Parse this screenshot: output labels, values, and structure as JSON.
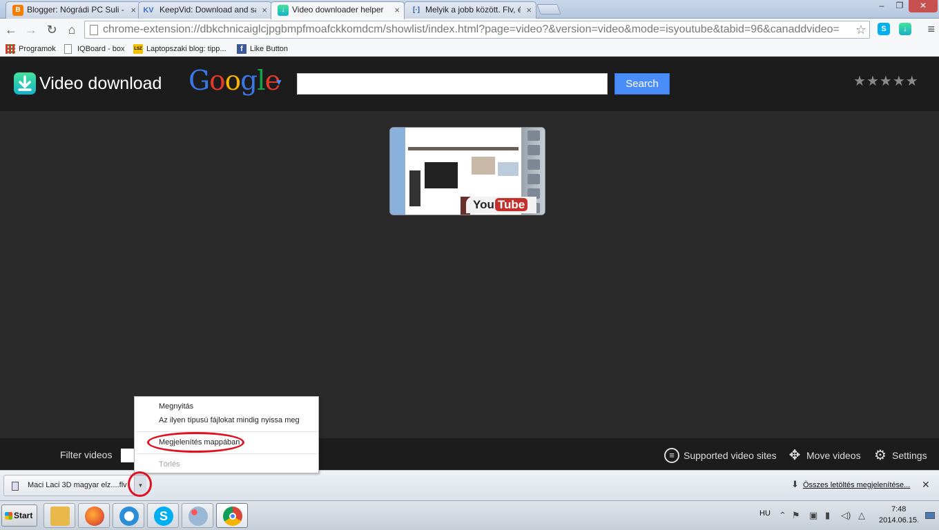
{
  "tabs": [
    {
      "label": "Blogger: Nógrádi PC Suli - Be",
      "icon": "blogger-icon",
      "color": "#f57d00"
    },
    {
      "label": "KeepVid: Download and save",
      "icon": "keepvid-icon",
      "badge": "KV"
    },
    {
      "label": "Video downloader helper",
      "icon": "video-download-icon",
      "color": "#2fc5a6"
    },
    {
      "label": "Melyik a jobb között. Flv, és",
      "icon": "page-icon",
      "badge": "[·]"
    }
  ],
  "window": {
    "minimize": "–",
    "maximize": "❐",
    "close": "✕"
  },
  "toolbar": {
    "url": "chrome-extension://dbkchnicaiglcjpgbmpfmoafckkomdcm/showlist/index.html?page=video?&version=video&mode=isyoutube&tabid=96&canaddvideo="
  },
  "bookmarks": [
    {
      "label": "Programok",
      "icon": "apps-grid-icon"
    },
    {
      "label": "IQBoard - box",
      "icon": "page-icon"
    },
    {
      "label": "Laptopszaki blog: tipp...",
      "icon": "laptopszaki-icon",
      "badge": "LSZ"
    },
    {
      "label": "Like Button",
      "icon": "facebook-icon",
      "badge": "f"
    }
  ],
  "app": {
    "title": "Video download",
    "google": "Google",
    "search_label": "Search",
    "rating_stars": 5
  },
  "thumbnail": {
    "yt_you": "You",
    "yt_tube": "Tube"
  },
  "footer": {
    "filter_label": "Filter videos",
    "supported_sites": "Supported video sites",
    "move_videos": "Move videos",
    "settings": "Settings"
  },
  "context_menu": {
    "open": "Megnyitás",
    "always_open": "Az ilyen típusú fájlokat mindig nyissa meg",
    "show_in_folder": "Megjelenítés mappában",
    "delete": "Törlés"
  },
  "downloads": {
    "file_name": "Maci Laci 3D magyar elz....flv",
    "show_all": "Összes letöltés megjelenítése...",
    "close": "✕"
  },
  "taskbar": {
    "start": "Start",
    "lang": "HU",
    "time": "7:48",
    "date": "2014.06.15.",
    "apps": [
      {
        "name": "explorer-icon",
        "color": "#e8b84a"
      },
      {
        "name": "firefox-icon",
        "color": "#e8602c"
      },
      {
        "name": "ie-icon",
        "color": "#2b8fd8"
      },
      {
        "name": "skype-icon",
        "color": "#00aff0"
      },
      {
        "name": "paint-icon",
        "color": "#9bb7d6"
      },
      {
        "name": "chrome-icon",
        "color": "#db4437"
      }
    ]
  },
  "colors": {
    "accent": "#4a8df8",
    "annotation": "#e01020"
  }
}
